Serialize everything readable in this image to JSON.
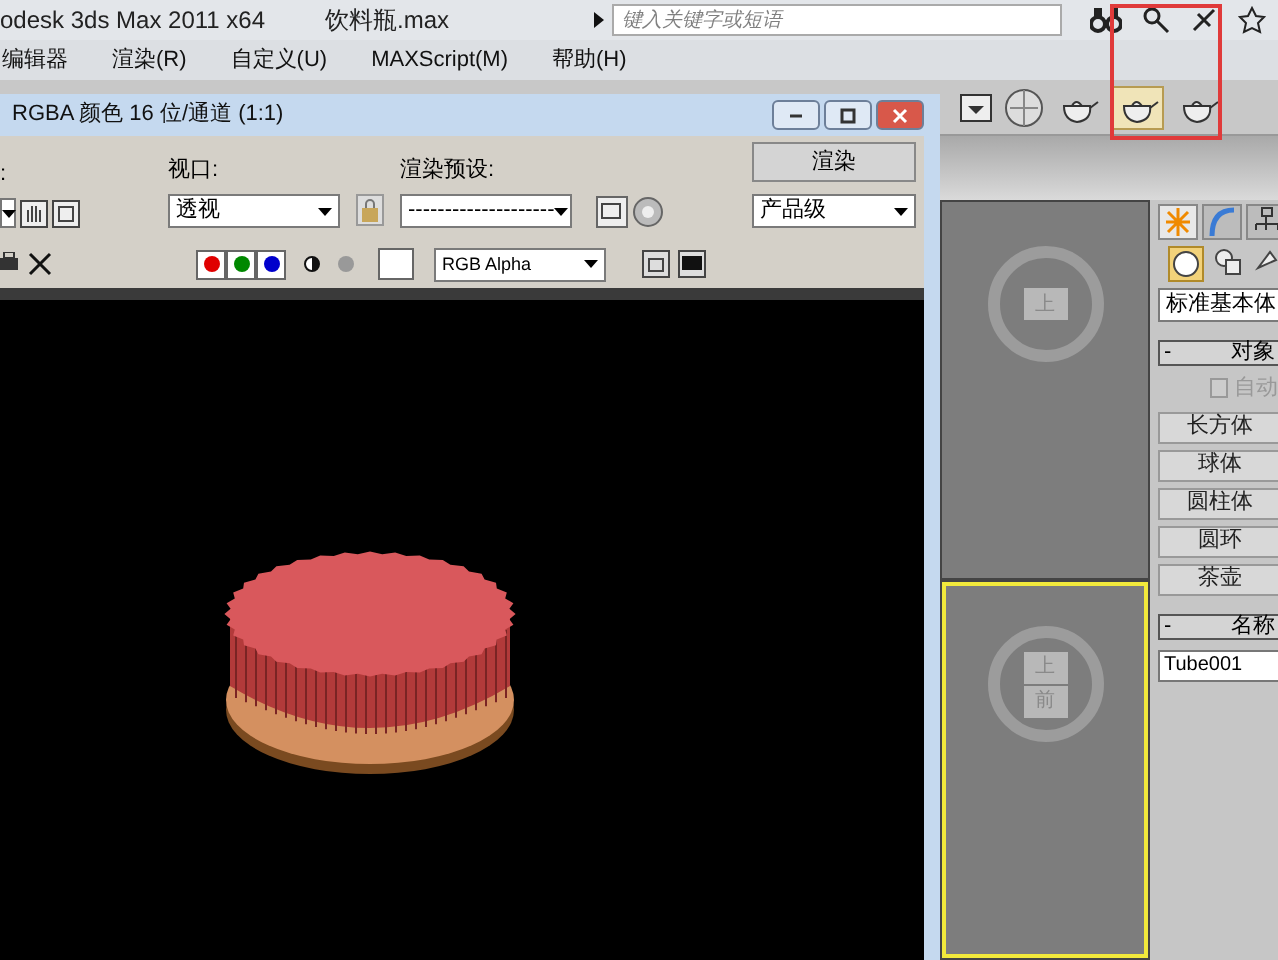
{
  "app": {
    "title": "odesk 3ds Max  2011 x64",
    "file_name": "饮料瓶.max",
    "search_placeholder": "键入关键字或短语"
  },
  "menu": [
    "编辑器",
    "渲染(R)",
    "自定义(U)",
    "MAXScript(M)",
    "帮助(H)"
  ],
  "render_window": {
    "title": "RGBA 颜色 16 位/通道 (1:1)",
    "left_label": ":",
    "viewport_label": "视口:",
    "viewport_value": "透视",
    "preset_label": "渲染预设:",
    "preset_value": "--------------------",
    "render_button": "渲染",
    "quality_value": "产品级",
    "channel_value": "RGB Alpha",
    "channels": [
      {
        "color": "#e00000",
        "on": true
      },
      {
        "color": "#008800",
        "on": true
      },
      {
        "color": "#0000cc",
        "on": true
      }
    ]
  },
  "viewports": [
    {
      "cube_labels": [
        "上"
      ],
      "active": false
    },
    {
      "cube_labels": [
        "上",
        "前"
      ],
      "active": true
    }
  ],
  "command_panel": {
    "category": "标准基本体",
    "object_rollout": "对象",
    "object_rollout_sign": "-",
    "auto_grid": {
      "label": "自动",
      "checked": false
    },
    "buttons": [
      "长方体",
      "球体",
      "圆柱体",
      "圆环",
      "茶壶"
    ],
    "name_rollout": "名称",
    "name_rollout_sign": "-",
    "name_value": "Tube001"
  }
}
